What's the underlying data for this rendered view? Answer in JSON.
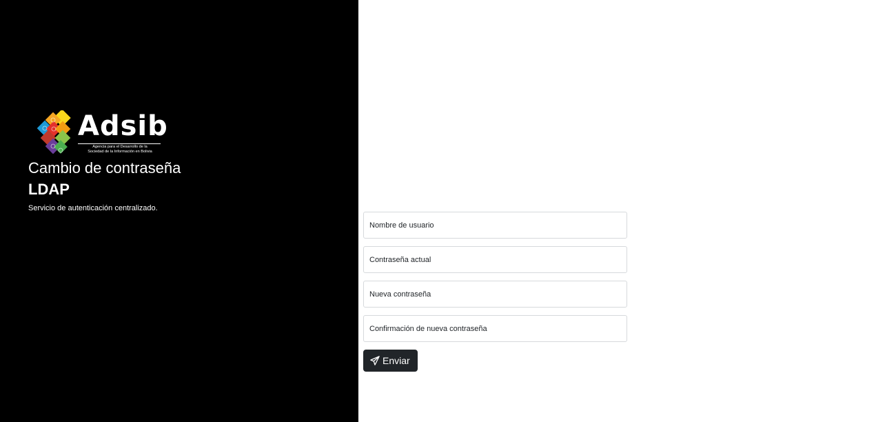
{
  "brand": {
    "logo_word": "Adsib",
    "logo_subtitle_line1": "Agencia para el Desarrollo de la",
    "logo_subtitle_line2": "Sociedad de la Información en Bolivia",
    "logo_colors": [
      "#f6a623",
      "#e4312b",
      "#1f9ad6",
      "#8bc34a",
      "#6a3d9a",
      "#f9d71c"
    ]
  },
  "header": {
    "title": "Cambio de contraseña",
    "subtitle": "LDAP",
    "description": "Servicio de autenticación centralizado."
  },
  "form": {
    "username_placeholder": "Nombre de usuario",
    "current_password_placeholder": "Contraseña actual",
    "new_password_placeholder": "Nueva contraseña",
    "confirm_password_placeholder": "Confirmación de nueva contraseña",
    "submit_label": "Enviar",
    "submit_icon": "paper-plane-icon"
  },
  "colors": {
    "left_panel_bg": "#000000",
    "button_bg": "#212529",
    "input_border": "#d6d9dc"
  }
}
